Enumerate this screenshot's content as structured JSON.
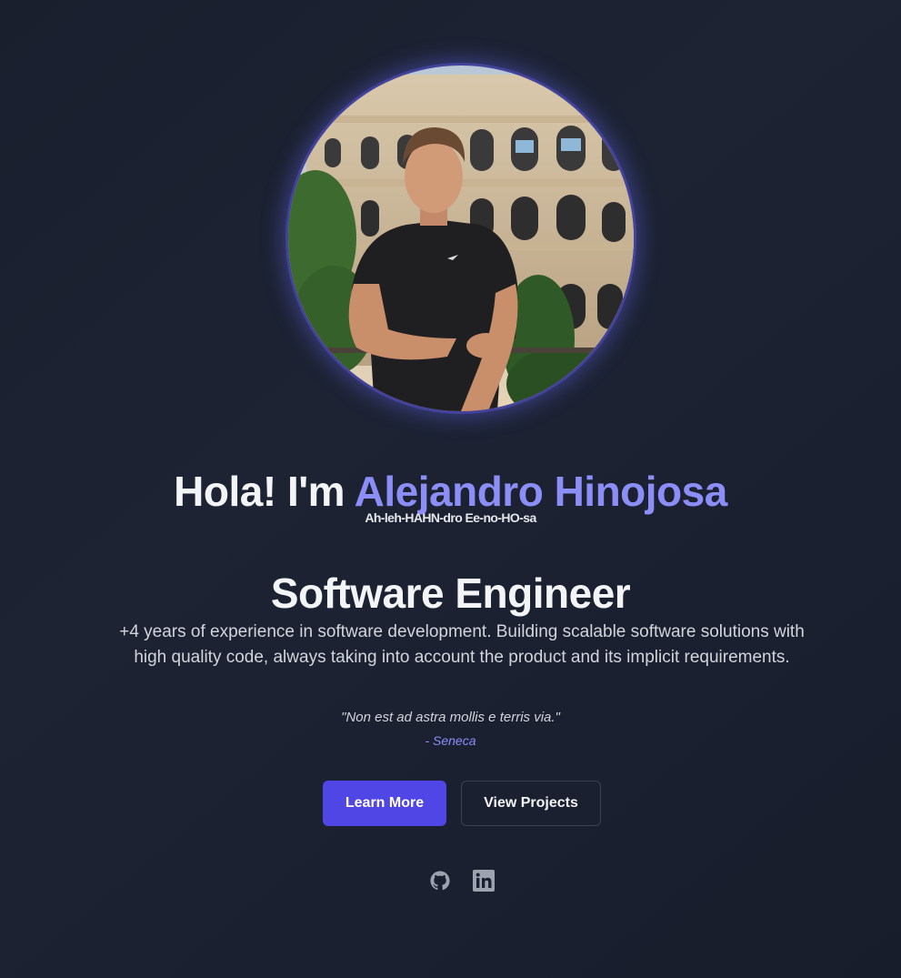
{
  "hero": {
    "greeting": "Hola! I'm ",
    "name": "Alejandro Hinojosa",
    "pronunciation": "Ah-leh-HAHN-dro Ee-no-HO-sa",
    "role": "Software Engineer",
    "description": "+4 years of experience in software development. Building scalable software solutions with high quality code, always taking into account the product and its implicit requirements.",
    "quote": "\"Non est ad astra mollis e terris via.\"",
    "quote_author": "- Seneca"
  },
  "buttons": {
    "primary_label": "Learn More",
    "secondary_label": "View Projects"
  },
  "social": {
    "github_icon": "github-icon",
    "linkedin_icon": "linkedin-icon"
  },
  "colors": {
    "accent": "#8b8ef7",
    "button_primary": "#5046e5",
    "background": "#1b2030"
  }
}
